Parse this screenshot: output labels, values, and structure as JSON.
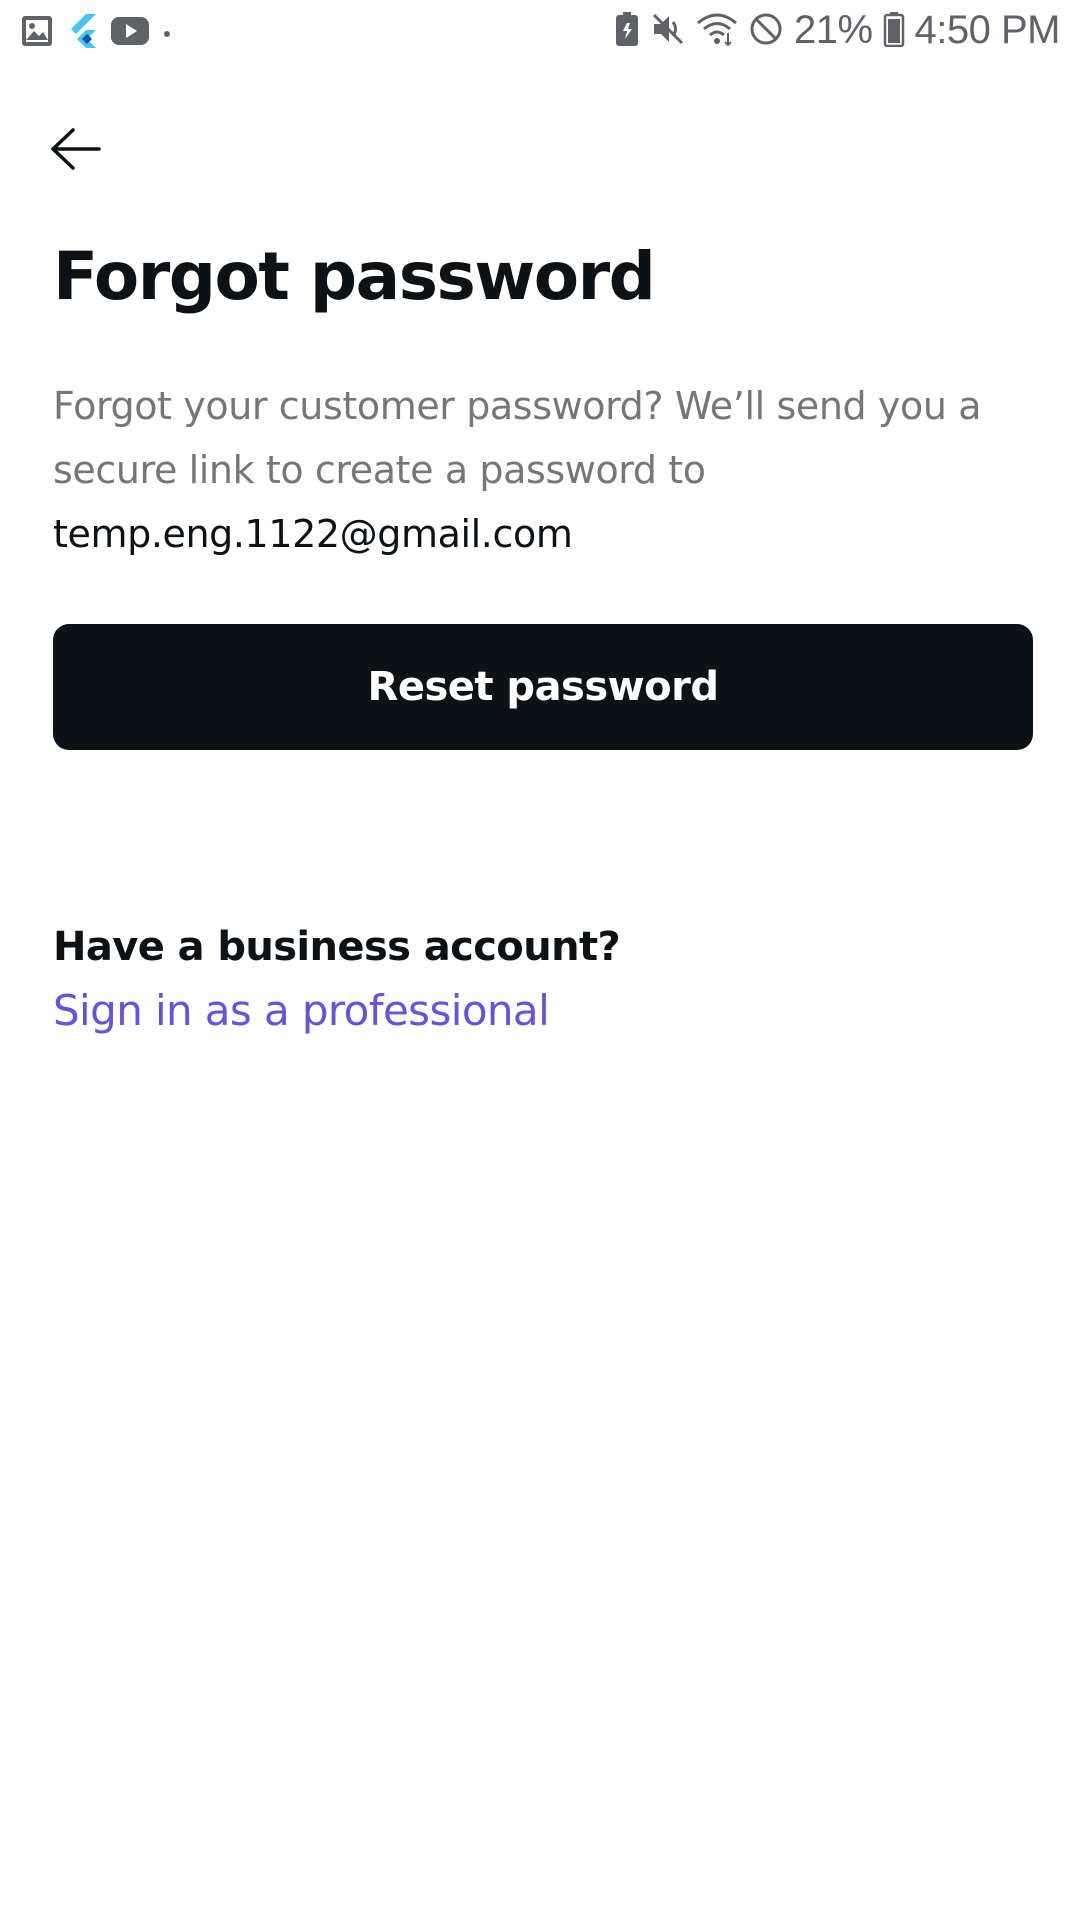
{
  "status_bar": {
    "battery_percent": "21%",
    "time": "4:50 PM",
    "left_icons": [
      "gallery-icon",
      "flutter-icon",
      "youtube-icon",
      "dot-icon"
    ],
    "right_icons": [
      "battery-saver-icon",
      "mute-icon",
      "wifi-icon",
      "do-not-disturb-icon",
      "battery-icon"
    ]
  },
  "header": {
    "back_icon": "arrow-left-icon"
  },
  "main": {
    "title": "Forgot password",
    "description": "Forgot your customer password? We’ll send you a secure link to create a password to",
    "email": "temp.eng.1122@gmail.com",
    "reset_button_label": "Reset password"
  },
  "business": {
    "question": "Have a business account?",
    "link_label": "Sign in as a professional"
  },
  "colors": {
    "primary_dark": "#0d1217",
    "muted_text": "#767676",
    "link_purple": "#6950e0",
    "background": "#ffffff"
  }
}
